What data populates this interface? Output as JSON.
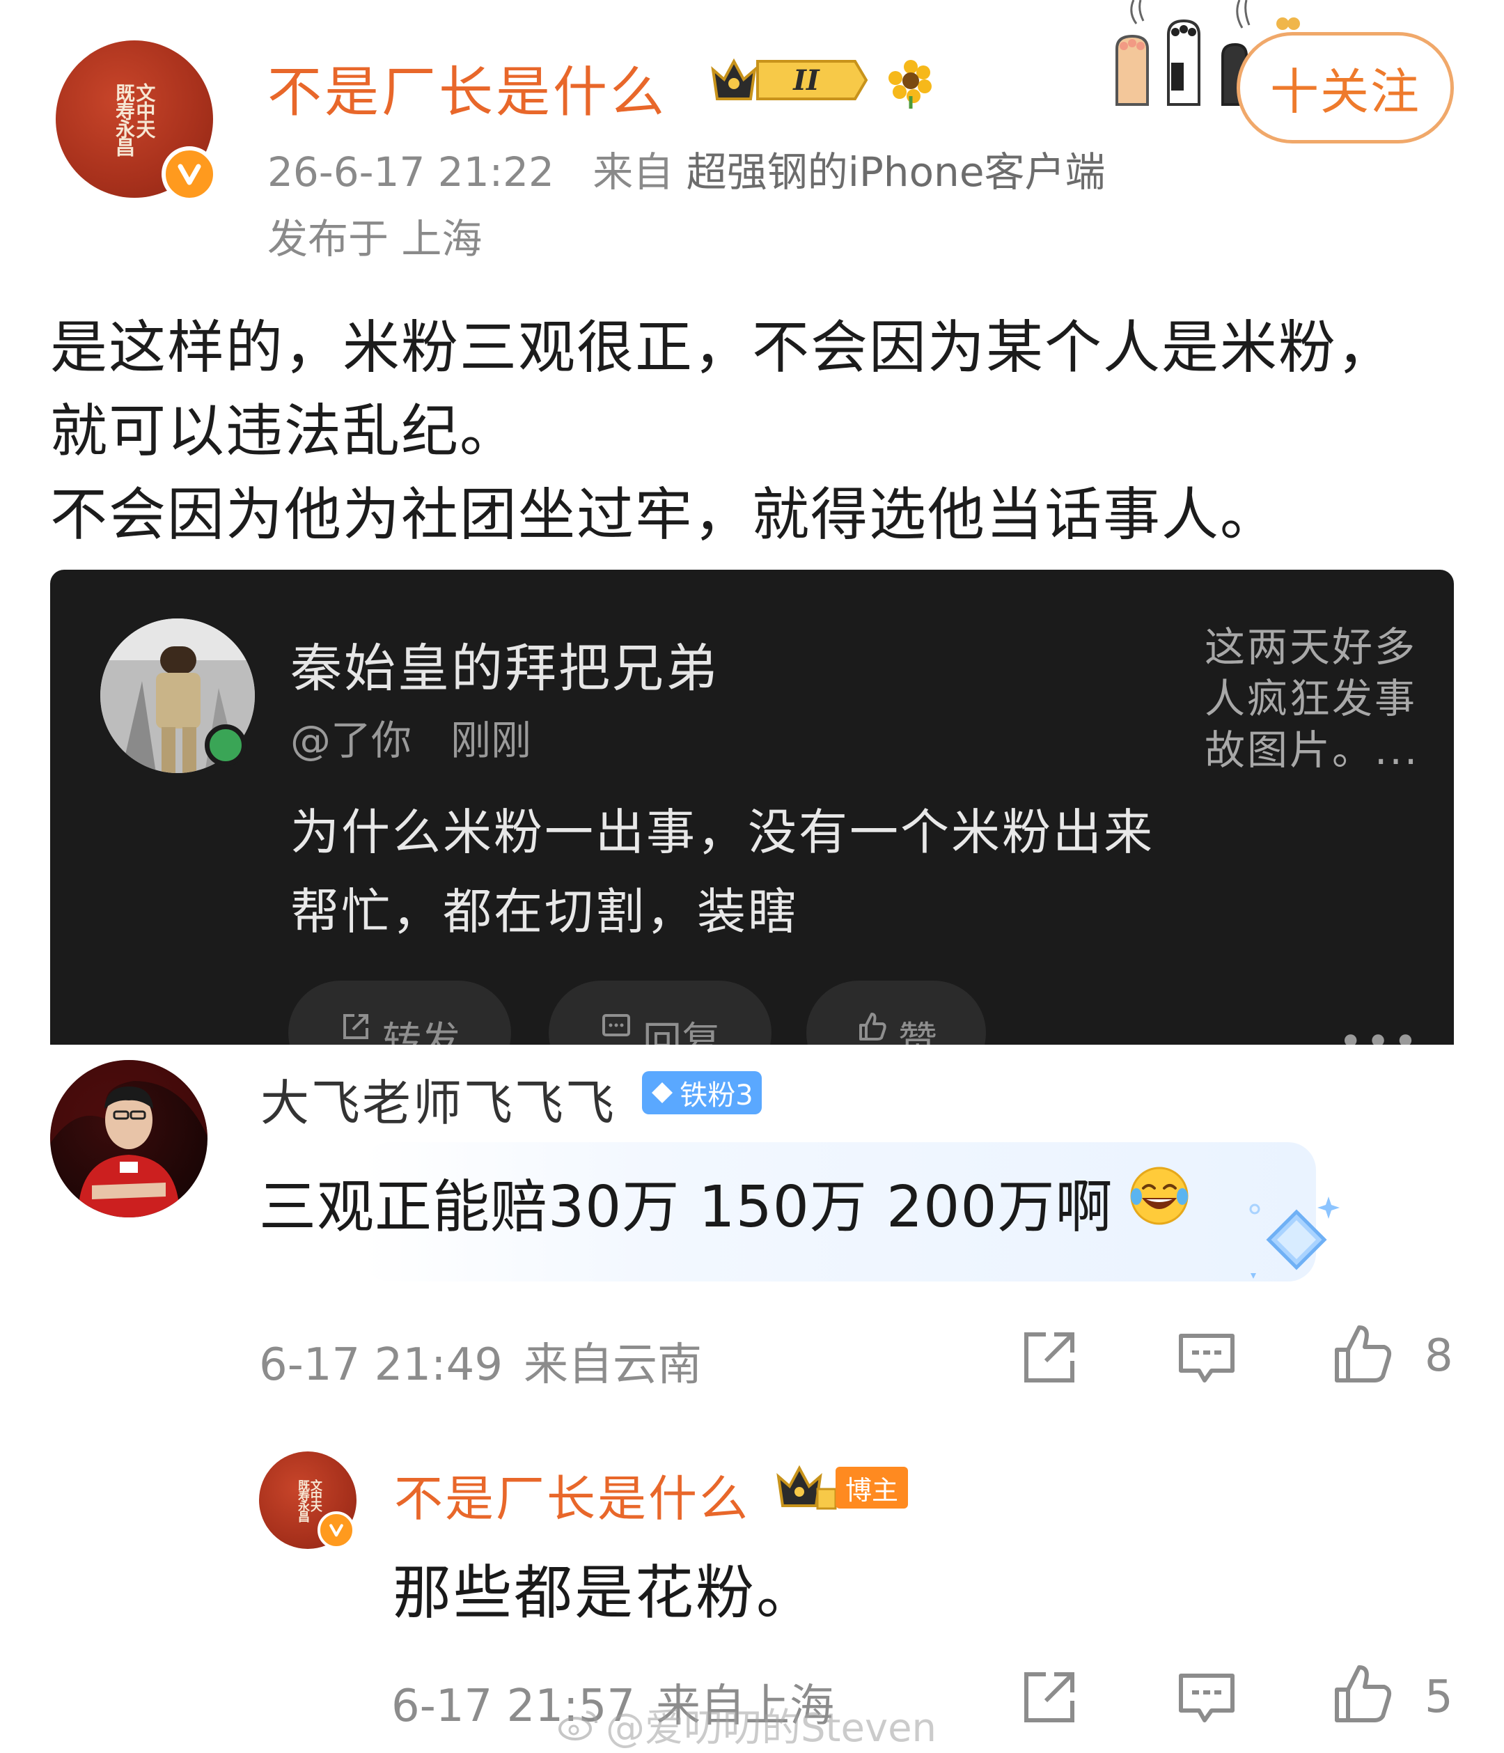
{
  "post": {
    "author": "不是厂长是什么",
    "level_badge": "II",
    "meta_time": "26-6-17 21:22",
    "meta_from": "来自",
    "meta_device": "超强钢的iPhone客户端",
    "location": "发布于 上海",
    "follow_label": "十关注",
    "body_lines": [
      "是这样的，米粉三观很正，不会因为某个人是米粉，就可以违法乱纪。",
      "不会因为他为社团坐过牢，就得选他当话事人。"
    ]
  },
  "embed": {
    "name": "秦始皇的拜把兄弟",
    "handle": "@了你",
    "time": "刚刚",
    "side_text": "这两天好多人疯狂发事故图片。...",
    "text": "为什么米粉一出事，没有一个米粉出来帮忙，都在切割，装瞎",
    "actions": {
      "repost": "转发",
      "reply": "回复",
      "like": "赞"
    },
    "more": "•••"
  },
  "comments": [
    {
      "name": "大飞老师飞飞飞",
      "badge": "铁粉3",
      "text": "三观正能赔30万 150万 200万啊",
      "time": "6-17 21:49",
      "location": "来自云南",
      "likes": "8"
    },
    {
      "name": "不是厂长是什么",
      "badge": "博主",
      "text": "那些都是花粉。",
      "time": "6-17 21:57",
      "location": "来自上海",
      "likes": "5"
    }
  ],
  "watermark": "@爱叨叨的Steven",
  "colors": {
    "author_orange": "#e8672a",
    "follow_border": "#f0a86a",
    "embed_bg": "#1b1b1b",
    "fan_badge_blue": "#5aa8ff",
    "author_badge_orange": "#ff8a20"
  }
}
